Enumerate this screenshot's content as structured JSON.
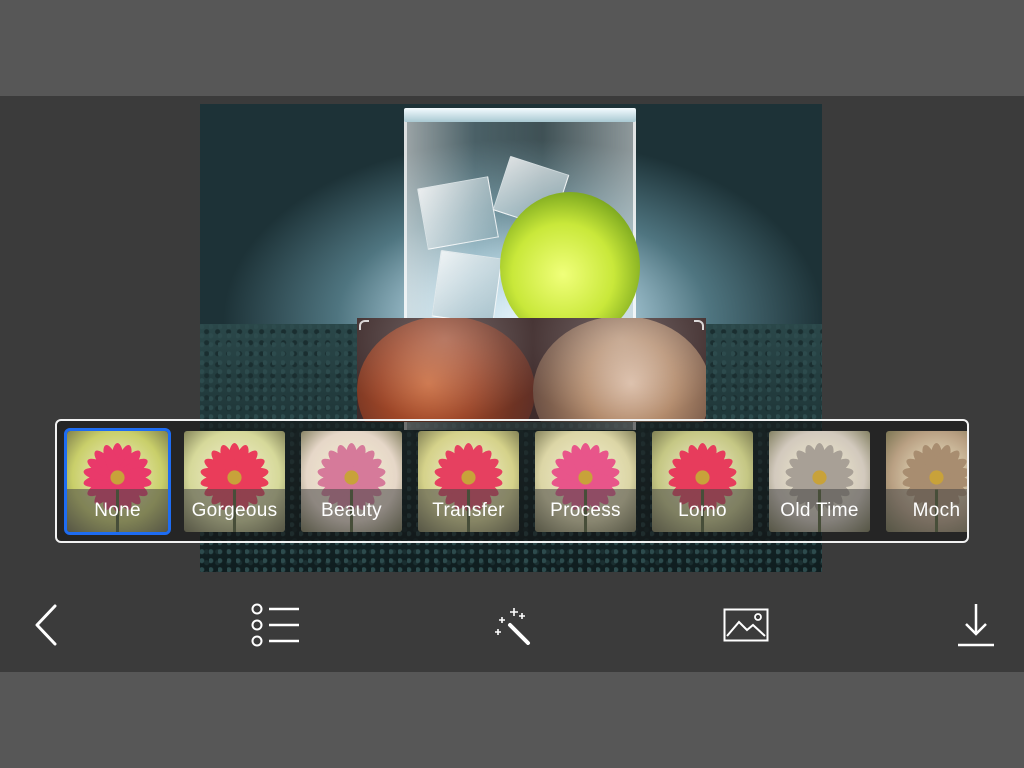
{
  "filters": [
    {
      "label": "None",
      "selected": true,
      "petal": "#e9396a",
      "bg": "#c9cf6a"
    },
    {
      "label": "Gorgeous",
      "selected": false,
      "petal": "#ea3c5a",
      "bg": "#d6d99a"
    },
    {
      "label": "Beauty",
      "selected": false,
      "petal": "#d67a9a",
      "bg": "#e6d7c8"
    },
    {
      "label": "Transfer",
      "selected": false,
      "petal": "#e64060",
      "bg": "#d5d28a"
    },
    {
      "label": "Process",
      "selected": false,
      "petal": "#e8558a",
      "bg": "#dcd6a6"
    },
    {
      "label": "Lomo",
      "selected": false,
      "petal": "#e73c5c",
      "bg": "#c5c784"
    },
    {
      "label": "Old Time",
      "selected": false,
      "petal": "#a8a096",
      "bg": "#d2c9bd"
    },
    {
      "label": "Moch",
      "selected": false,
      "petal": "#a88d70",
      "bg": "#b9a083"
    }
  ],
  "toolbar": {
    "items": [
      {
        "name": "back-button",
        "icon": "chevron-left-icon"
      },
      {
        "name": "list-button",
        "icon": "list-icon"
      },
      {
        "name": "effects-button",
        "icon": "magic-wand-icon"
      },
      {
        "name": "image-button",
        "icon": "image-icon"
      },
      {
        "name": "download-button",
        "icon": "download-icon"
      }
    ]
  },
  "colors": {
    "selected_border": "#1e6cf2",
    "strip_border": "#f2f2f2",
    "toolbar_bg": "#3b3b3b",
    "band_bg": "#575757"
  }
}
